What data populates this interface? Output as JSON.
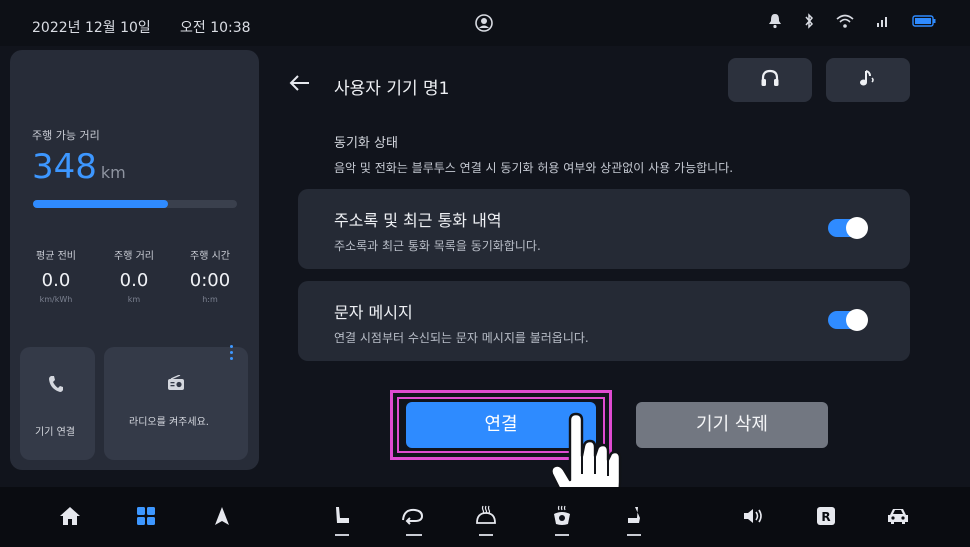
{
  "status_bar": {
    "date": "2022년 12월 10일",
    "time": "오전 10:38",
    "icons": [
      "user-icon",
      "bell-icon",
      "bluetooth-icon",
      "wifi-icon",
      "signal-icon",
      "battery-icon"
    ]
  },
  "driving": {
    "range_label": "주행 가능 거리",
    "range_value": "348",
    "range_unit": "km",
    "range_fill_fraction": 0.66,
    "stats": [
      {
        "label": "평균 전비",
        "value": "0.0",
        "unit": "km/kWh"
      },
      {
        "label": "주행 거리",
        "value": "0.0",
        "unit": "km"
      },
      {
        "label": "주행 시간",
        "value": "0:00",
        "unit": "h:m"
      }
    ]
  },
  "tiles": {
    "phone_label": "기기 연결",
    "radio_label": "라디오를 켜주세요."
  },
  "header": {
    "title": "사용자 기기 명1",
    "buttons": [
      "headphones-icon",
      "music-note-icon"
    ]
  },
  "sync": {
    "title": "동기화 상태",
    "description": "음악 및 전화는 블루투스 연결 시 동기화 허용 여부와 상관없이 사용 가능합니다."
  },
  "options": [
    {
      "title": "주소록 및 최근 통화 내역",
      "description": "주소록과 최근 통화 목록을 동기화합니다.",
      "enabled": true
    },
    {
      "title": "문자 메시지",
      "description": "연결 시점부터 수신되는 문자 메시지를 불러옵니다.",
      "enabled": true
    }
  ],
  "actions": {
    "connect_label": "연결",
    "delete_label": "기기 삭제"
  },
  "colors": {
    "accent": "#2e8bff",
    "highlight": "#e04bd1",
    "card": "#252a35",
    "background": "#11141c"
  },
  "bottom_nav": [
    "home-icon",
    "apps-grid-icon",
    "navigation-arrow-icon",
    "seat-icon",
    "air-recirculation-icon",
    "rear-defrost-icon",
    "front-defrost-icon",
    "seat-heat-icon",
    "volume-icon",
    "radio-icon",
    "car-icon"
  ]
}
